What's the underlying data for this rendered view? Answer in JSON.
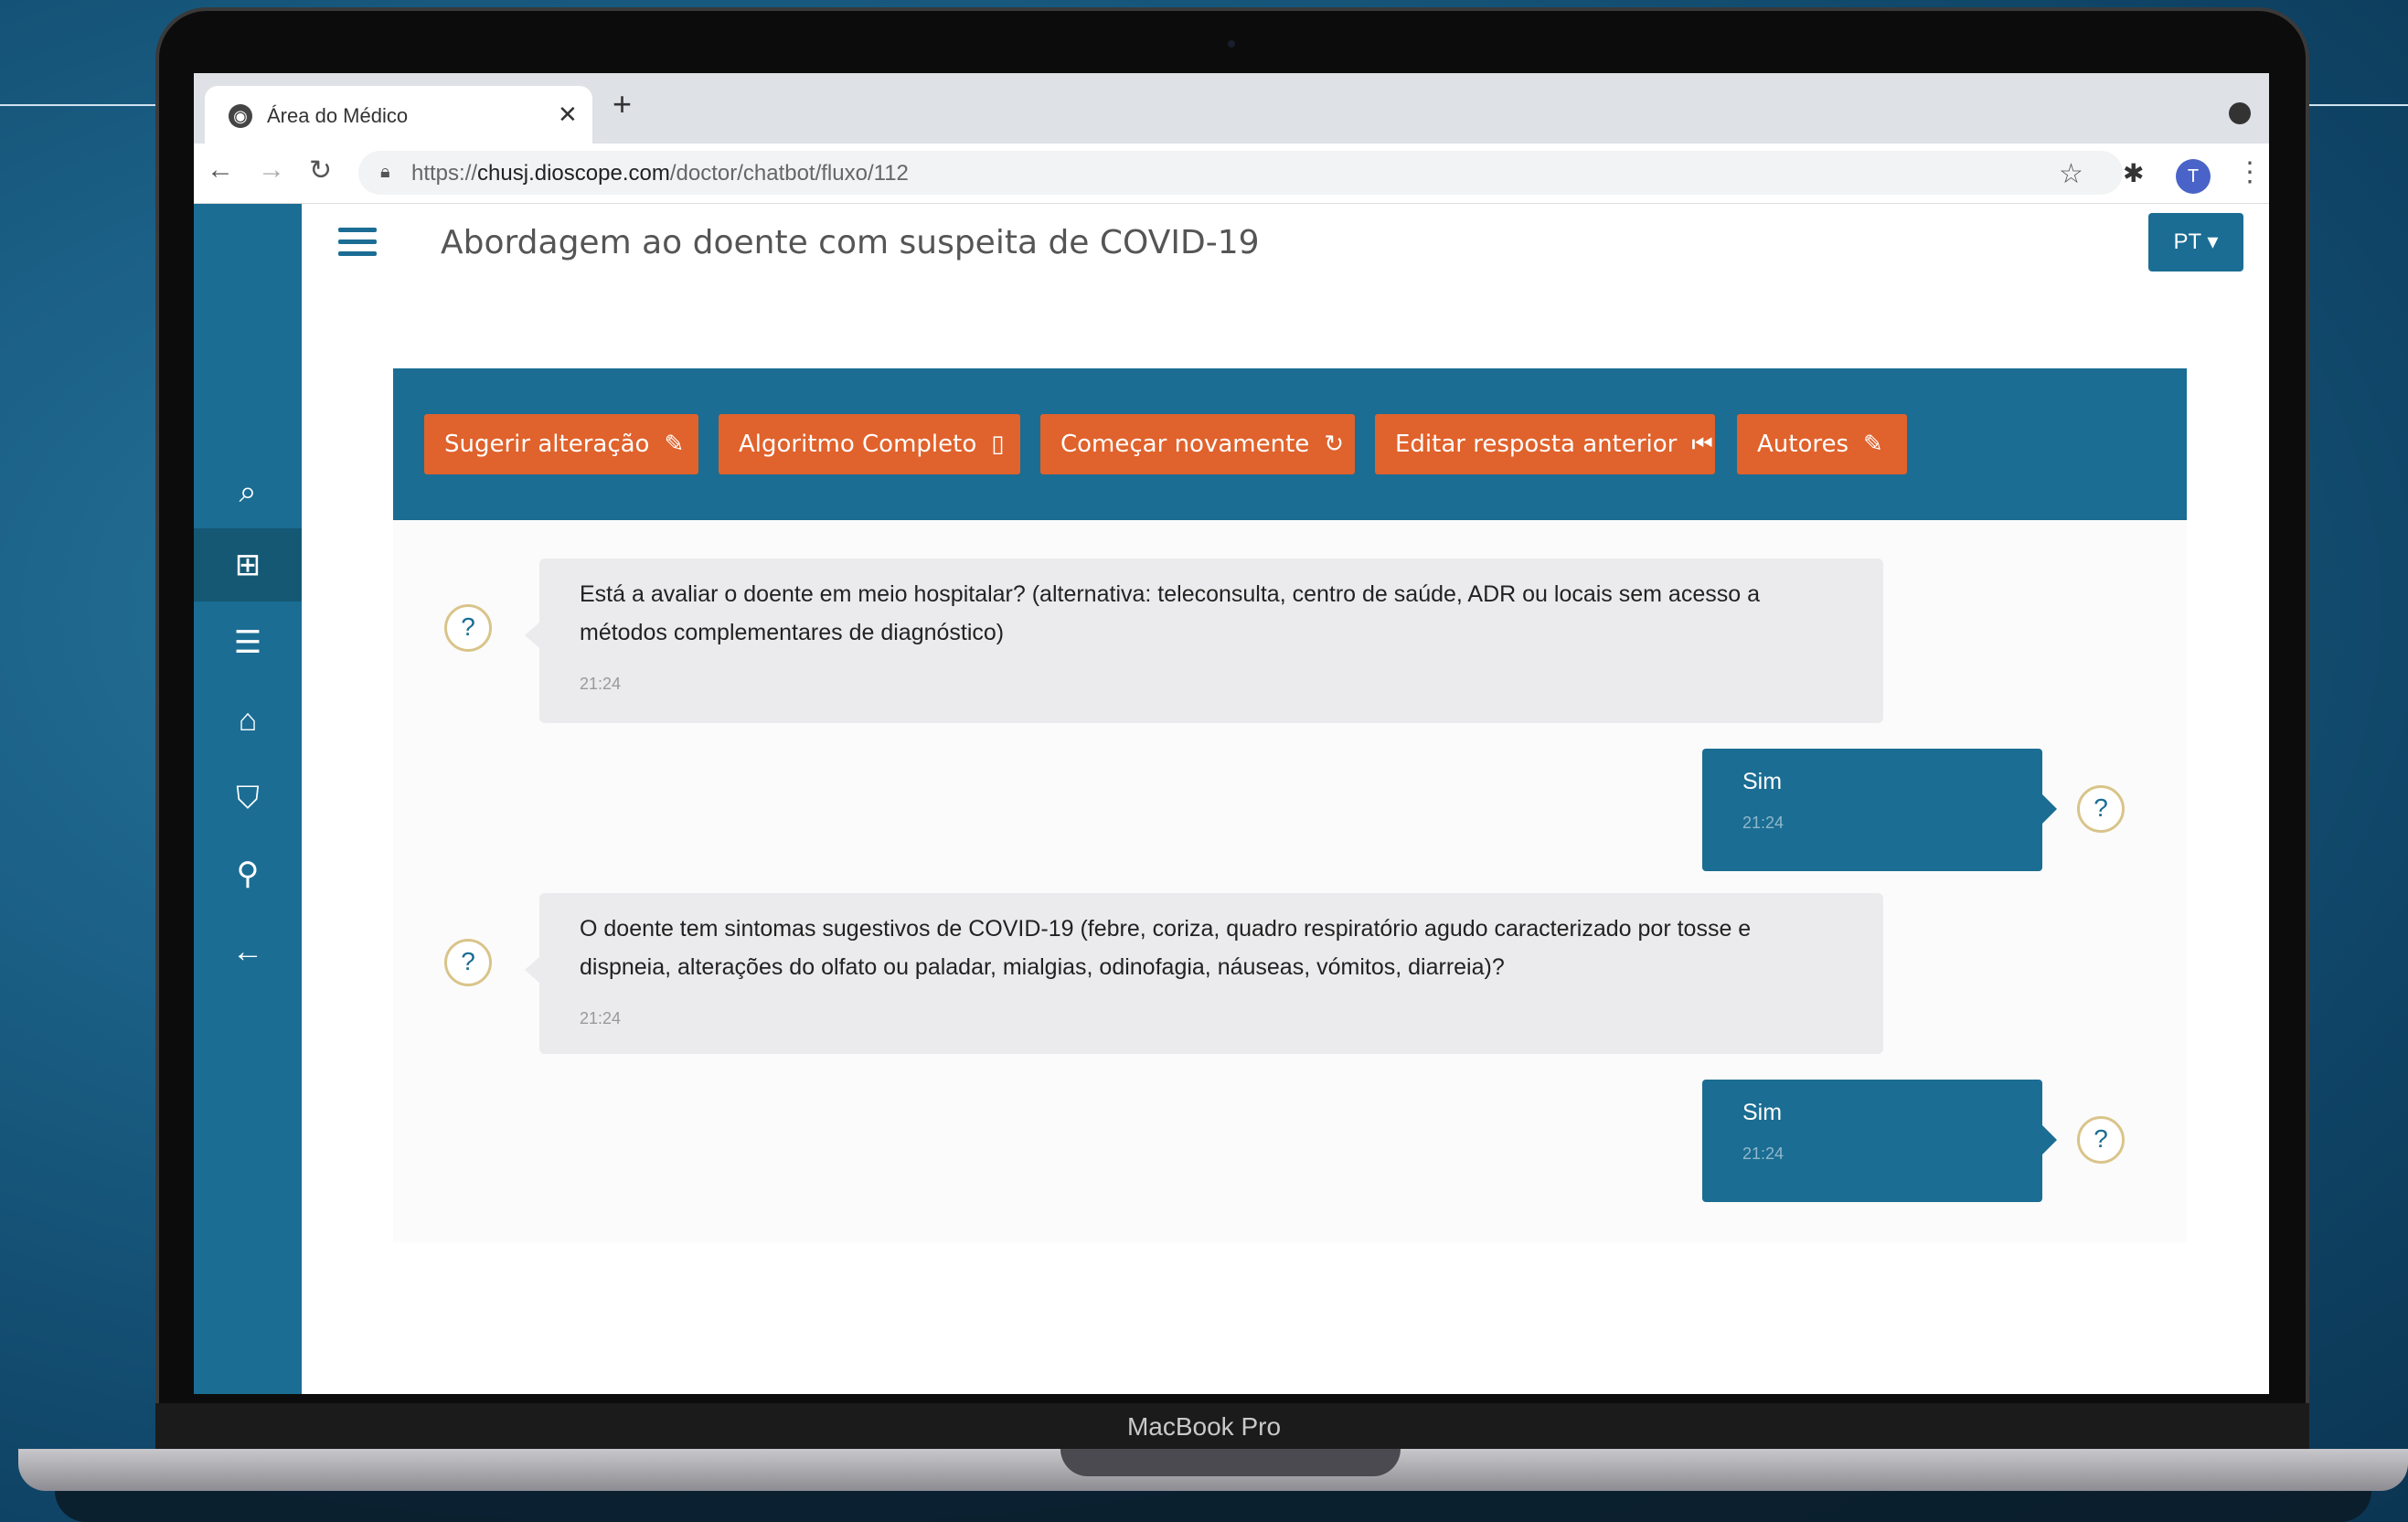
{
  "browser": {
    "tab_title": "Área do Médico",
    "tab_close": "✕",
    "new_tab": "+",
    "url_prefix": "https://",
    "url_domain": "chusj.dioscope.com",
    "url_path": "/doctor/chatbot/fluxo/112",
    "profile_initial": "T"
  },
  "device": {
    "label": "MacBook Pro"
  },
  "header": {
    "title": "Abordagem ao doente com suspeita de COVID-19",
    "language": "PT ▾"
  },
  "sidebar": {
    "items": [
      {
        "icon": "search-icon"
      },
      {
        "icon": "sitemap-icon",
        "active": true
      },
      {
        "icon": "list-icon"
      },
      {
        "icon": "institution-icon"
      },
      {
        "icon": "graduation-cap-icon"
      },
      {
        "icon": "pin-icon"
      },
      {
        "icon": "arrow-left-icon"
      }
    ]
  },
  "actions": {
    "suggest": "Sugerir alteração",
    "algorithm": "Algoritmo Completo",
    "restart": "Começar novamente",
    "edit_prev": "Editar resposta anterior",
    "authors": "Autores"
  },
  "chat": {
    "messages": [
      {
        "from": "bot",
        "text": "Está a avaliar o doente em meio hospitalar? (alternativa: teleconsulta, centro de saúde, ADR ou locais sem acesso a métodos complementares de diagnóstico)",
        "time": "21:24"
      },
      {
        "from": "user",
        "text": "Sim",
        "time": "21:24"
      },
      {
        "from": "bot",
        "text": "O doente tem sintomas sugestivos de COVID-19 (febre, coriza, quadro respiratório agudo caracterizado por tosse e dispneia, alterações do olfato ou paladar, mialgias, odinofagia, náuseas, vómitos, diarreia)?",
        "time": "21:24"
      },
      {
        "from": "user",
        "text": "Sim",
        "time": "21:24"
      }
    ]
  },
  "colors": {
    "primary": "#1b6d93",
    "accent": "#e0622c"
  }
}
